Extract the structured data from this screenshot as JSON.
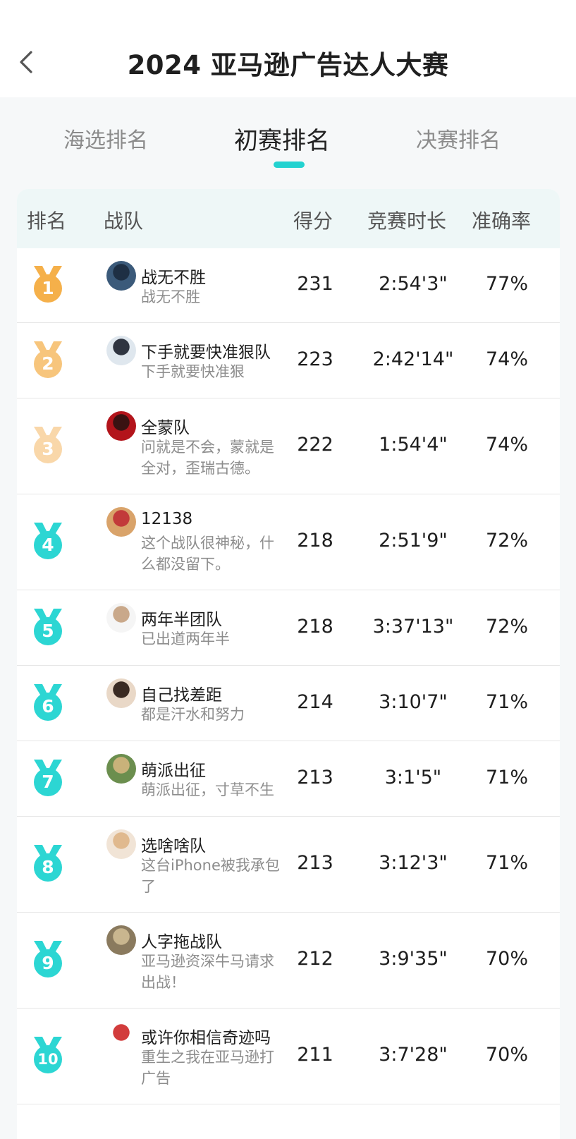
{
  "header": {
    "title": "2024 亚马逊广告达人大赛"
  },
  "tabs": [
    {
      "label": "海选排名"
    },
    {
      "label": "初赛排名"
    },
    {
      "label": "决赛排名"
    }
  ],
  "table": {
    "columns": [
      "排名",
      "战队",
      "得分",
      "竞赛时长",
      "准确率"
    ],
    "rows": [
      {
        "rank": "1",
        "name": "战无不胜",
        "desc": "战无不胜",
        "score": "231",
        "time": "2:54'3\"",
        "accuracy": "77%"
      },
      {
        "rank": "2",
        "name": "下手就要快准狠队",
        "desc": "下手就要快准狠",
        "score": "223",
        "time": "2:42'14\"",
        "accuracy": "74%"
      },
      {
        "rank": "3",
        "name": "全蒙队",
        "desc": "问就是不会，蒙就是全对，歪瑞古德。",
        "score": "222",
        "time": "1:54'4\"",
        "accuracy": "74%"
      },
      {
        "rank": "4",
        "name": "12138",
        "desc": "这个战队很神秘，什么都没留下。",
        "score": "218",
        "time": "2:51'9\"",
        "accuracy": "72%"
      },
      {
        "rank": "5",
        "name": "两年半团队",
        "desc": "已出道两年半",
        "score": "218",
        "time": "3:37'13\"",
        "accuracy": "72%"
      },
      {
        "rank": "6",
        "name": "自己找差距",
        "desc": "都是汗水和努力",
        "score": "214",
        "time": "3:10'7\"",
        "accuracy": "71%"
      },
      {
        "rank": "7",
        "name": "萌派出征",
        "desc": "萌派出征，寸草不生",
        "score": "213",
        "time": "3:1'5\"",
        "accuracy": "71%"
      },
      {
        "rank": "8",
        "name": "选啥啥队",
        "desc": "这台iPhone被我承包了",
        "score": "213",
        "time": "3:12'3\"",
        "accuracy": "71%"
      },
      {
        "rank": "9",
        "name": "人字拖战队",
        "desc": "亚马逊资深牛马请求出战！",
        "score": "212",
        "time": "3:9'35\"",
        "accuracy": "70%"
      },
      {
        "rank": "10",
        "name": "或许你相信奇迹吗",
        "desc": "重生之我在亚马逊打广告",
        "score": "211",
        "time": "3:7'28\"",
        "accuracy": "70%"
      }
    ]
  },
  "colors": {
    "accent": "#23d2d0",
    "gold": "#f5b04a",
    "silver": "#f7c57c",
    "bronze": "#f9d7a9",
    "teal_medal": "#2cd6d3"
  },
  "icons": {
    "back": "chevron-left-icon",
    "medal": "medal-icon",
    "avatar": "avatar-icon"
  }
}
